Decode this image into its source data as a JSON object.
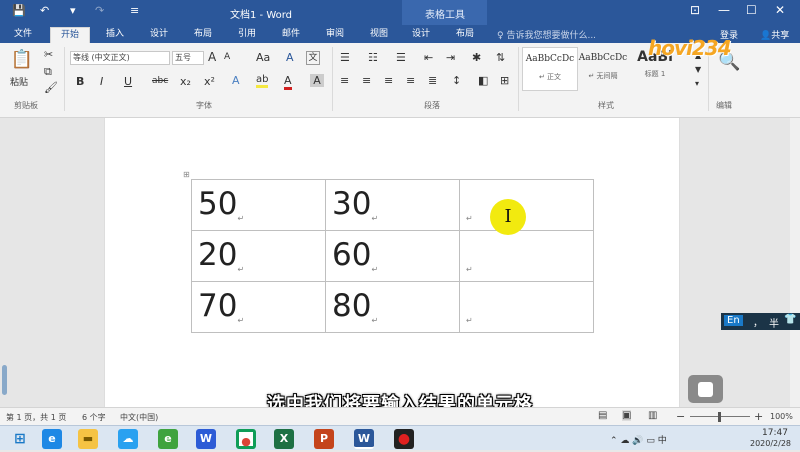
{
  "titlebar": {
    "title": "文档1 - Word",
    "context_tab": "表格工具",
    "minimize": "—",
    "maximize": "☐",
    "close": "✕",
    "save": "💾",
    "undo": "↶",
    "redo": "↷"
  },
  "tabs": [
    "文件",
    "开始",
    "插入",
    "设计",
    "布局",
    "引用",
    "邮件",
    "审阅",
    "视图",
    "设计",
    "布局"
  ],
  "tellme": "告诉我您想要做什么...",
  "account": {
    "login": "登录",
    "share": "共享"
  },
  "ribbon": {
    "clipboard": {
      "paste": "粘贴",
      "label": "剪贴板"
    },
    "font": {
      "name": "等线 (中文正文)",
      "size": "五号",
      "label": "字体",
      "bold": "B",
      "italic": "I",
      "underline": "U",
      "strike": "abc",
      "sub": "x₂",
      "sup": "x²",
      "grow": "A",
      "shrink": "A",
      "aa": "Aa",
      "wen": "文",
      "clear": "A"
    },
    "paragraph": {
      "label": "段落"
    },
    "styles": {
      "label": "样式",
      "items": [
        {
          "sample": "AaBbCcDc",
          "name": "↵ 正文"
        },
        {
          "sample": "AaBbCcDc",
          "name": "↵ 无间隔"
        },
        {
          "sample": "AaBl",
          "name": "标题 1"
        }
      ]
    },
    "editing": {
      "label": "编辑"
    }
  },
  "table": [
    [
      "50",
      "30",
      ""
    ],
    [
      "20",
      "60",
      ""
    ],
    [
      "70",
      "80",
      ""
    ]
  ],
  "cursor_glyph": "I",
  "subtitle": "选中我们将要输入结果的单元格",
  "status": {
    "page": "第 1 页，共 1 页",
    "words": "6 个字",
    "lang": "中文(中国)",
    "zoom": "100%",
    "minus": "−",
    "plus": "+"
  },
  "ime": {
    "lang": "En",
    "punct": "，",
    "width": "半"
  },
  "logo": "hovi234",
  "clock": {
    "time": "17:47",
    "date": "2020/2/28"
  }
}
